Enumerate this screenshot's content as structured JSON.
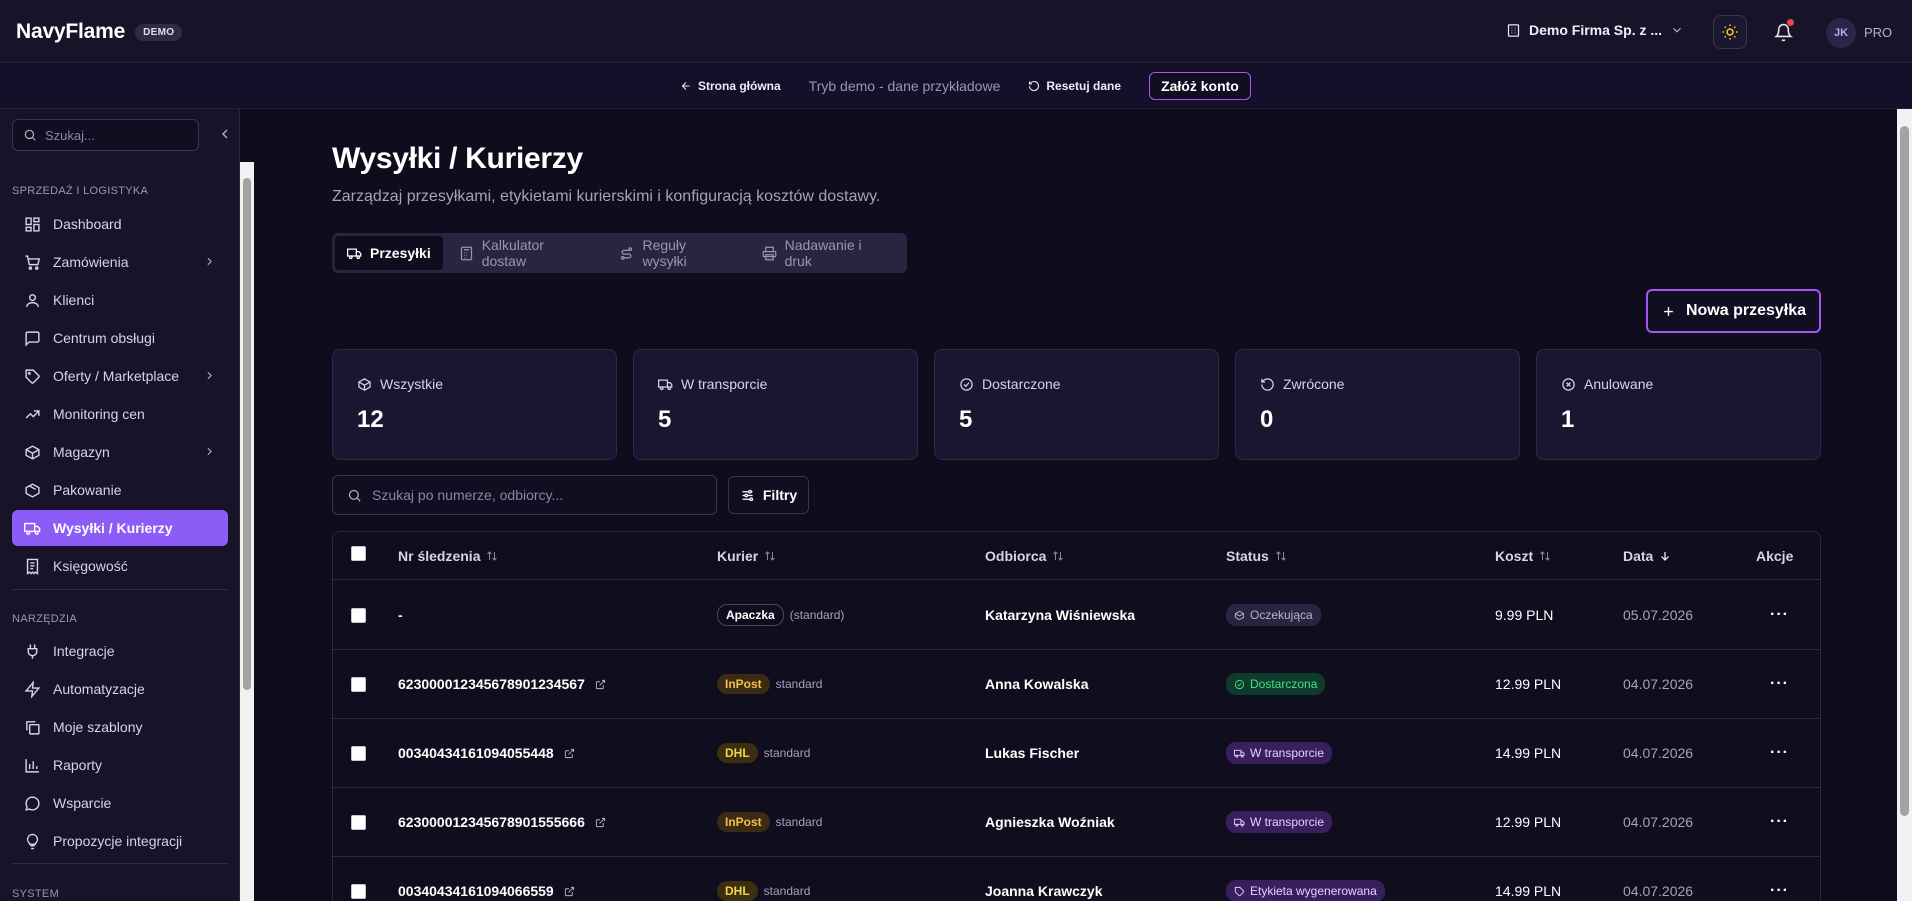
{
  "header": {
    "brand": "NavyFlame",
    "badge": "DEMO",
    "company": "Demo Firma Sp. z ...",
    "avatar": "JK",
    "plan": "PRO"
  },
  "demobar": {
    "home": "Strona główna",
    "mode_text": "Tryb demo - dane przykładowe",
    "reset": "Resetuj dane",
    "cta": "Załóż konto"
  },
  "sidebar": {
    "search_placeholder": "Szukaj...",
    "section_sales": "SPRZEDAŻ I LOGISTYKA",
    "section_tools": "NARZĘDZIA",
    "section_system": "SYSTEM",
    "items": [
      {
        "label": "Dashboard",
        "icon": "dashboard-icon"
      },
      {
        "label": "Zamówienia",
        "icon": "cart-icon",
        "expandable": true
      },
      {
        "label": "Klienci",
        "icon": "user-icon"
      },
      {
        "label": "Centrum obsługi",
        "icon": "chat-icon"
      },
      {
        "label": "Oferty / Marketplace",
        "icon": "tag-icon",
        "expandable": true
      },
      {
        "label": "Monitoring cen",
        "icon": "trend-icon"
      },
      {
        "label": "Magazyn",
        "icon": "box-icon",
        "expandable": true
      },
      {
        "label": "Pakowanie",
        "icon": "package-icon"
      },
      {
        "label": "Wysyłki / Kurierzy",
        "icon": "truck-icon",
        "active": true
      },
      {
        "label": "Księgowość",
        "icon": "receipt-icon"
      }
    ],
    "tools": [
      {
        "label": "Integracje",
        "icon": "plug-icon"
      },
      {
        "label": "Automatyzacje",
        "icon": "bolt-icon"
      },
      {
        "label": "Moje szablony",
        "icon": "copy-icon"
      },
      {
        "label": "Raporty",
        "icon": "bar-chart-icon"
      },
      {
        "label": "Wsparcie",
        "icon": "help-chat-icon"
      },
      {
        "label": "Propozycje integracji",
        "icon": "bulb-icon"
      }
    ]
  },
  "page": {
    "title": "Wysyłki / Kurierzy",
    "subtitle": "Zarządzaj przesyłkami, etykietami kurierskimi i konfiguracją kosztów dostawy.",
    "tabs": [
      "Przesyłki",
      "Kalkulator dostaw",
      "Reguły wysyłki",
      "Nadawanie i druk"
    ],
    "new_button": "Nowa przesyłka",
    "search_placeholder": "Szukaj po numerze, odbiorcy...",
    "filters": "Filtry"
  },
  "stats": [
    {
      "label": "Wszystkie",
      "value": "12"
    },
    {
      "label": "W transporcie",
      "value": "5"
    },
    {
      "label": "Dostarczone",
      "value": "5"
    },
    {
      "label": "Zwrócone",
      "value": "0"
    },
    {
      "label": "Anulowane",
      "value": "1"
    }
  ],
  "table": {
    "columns": [
      "Nr śledzenia",
      "Kurier",
      "Odbiorca",
      "Status",
      "Koszt",
      "Data",
      "Akcje"
    ],
    "rows": [
      {
        "tracking": "-",
        "courier": "Apaczka",
        "service": "(standard)",
        "recipient": "Katarzyna Wiśniewska",
        "status": "Oczekująca",
        "cost": "9.99 PLN",
        "date": "05.07.2026"
      },
      {
        "tracking": "623000012345678901234567",
        "courier": "InPost",
        "service": "standard",
        "recipient": "Anna Kowalska",
        "status": "Dostarczona",
        "cost": "12.99 PLN",
        "date": "04.07.2026"
      },
      {
        "tracking": "00340434161094055448",
        "courier": "DHL",
        "service": "standard",
        "recipient": "Lukas Fischer",
        "status": "W transporcie",
        "cost": "14.99 PLN",
        "date": "04.07.2026"
      },
      {
        "tracking": "623000012345678901555666",
        "courier": "InPost",
        "service": "standard",
        "recipient": "Agnieszka Woźniak",
        "status": "W transporcie",
        "cost": "12.99 PLN",
        "date": "04.07.2026"
      },
      {
        "tracking": "00340434161094066559",
        "courier": "DHL",
        "service": "standard",
        "recipient": "Joanna Krawczyk",
        "status": "Etykieta wygenerowana",
        "cost": "14.99 PLN",
        "date": "04.07.2026"
      }
    ],
    "actions_glyph": "···"
  },
  "colors": {
    "accent": "#8b5cf6",
    "accent_border": "#a855f7",
    "background": "#0f0c1d",
    "panel": "#181329"
  }
}
